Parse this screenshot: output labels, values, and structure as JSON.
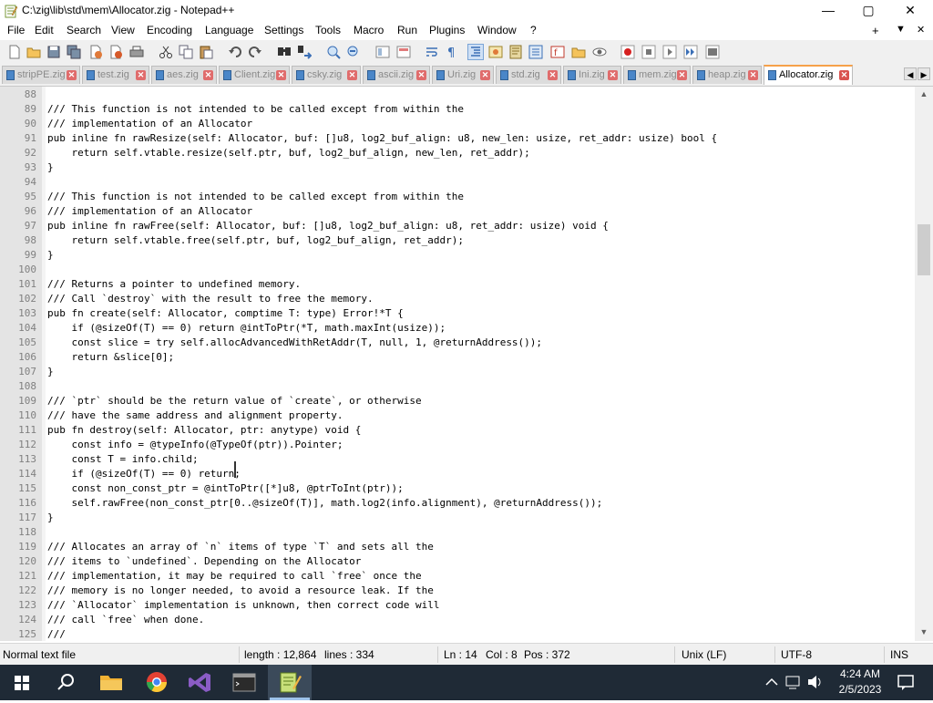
{
  "window": {
    "title": "C:\\zig\\lib\\std\\mem\\Allocator.zig - Notepad++",
    "controls": {
      "minimize": "—",
      "maximize": "▢",
      "close": "✕"
    }
  },
  "menu": {
    "items": [
      "File",
      "Edit",
      "Search",
      "View",
      "Encoding",
      "Language",
      "Settings",
      "Tools",
      "Macro",
      "Run",
      "Plugins",
      "Window",
      "?"
    ],
    "right": {
      "plus": "+",
      "dropdown": "▼",
      "close": "✕"
    }
  },
  "toolbar": {
    "icons": [
      "new-file-icon",
      "open-file-icon",
      "save-icon",
      "save-all-icon",
      "close-icon",
      "close-all-icon",
      "print-icon",
      "cut-icon",
      "copy-icon",
      "paste-icon",
      "undo-icon",
      "redo-icon",
      "find-icon",
      "replace-icon",
      "zoom-in-icon",
      "zoom-out-icon",
      "sync-vertical-icon",
      "sync-horizontal-icon",
      "word-wrap-icon",
      "show-all-chars-icon",
      "indent-guide-icon",
      "udl-icon",
      "doc-map-icon",
      "function-list-icon",
      "folder-as-workspace-icon",
      "monitor-icon",
      "record-macro-icon",
      "stop-record-icon",
      "play-macro-icon",
      "run-multiple-icon",
      "save-macro-icon"
    ]
  },
  "tabs": [
    {
      "label": "stripPE.zig",
      "active": false
    },
    {
      "label": "test.zig",
      "active": false
    },
    {
      "label": "aes.zig",
      "active": false
    },
    {
      "label": "Client.zig",
      "active": false
    },
    {
      "label": "csky.zig",
      "active": false
    },
    {
      "label": "ascii.zig",
      "active": false
    },
    {
      "label": "Uri.zig",
      "active": false
    },
    {
      "label": "std.zig",
      "active": false
    },
    {
      "label": "Ini.zig",
      "active": false
    },
    {
      "label": "mem.zig",
      "active": false
    },
    {
      "label": "heap.zig",
      "active": false
    },
    {
      "label": "Allocator.zig",
      "active": true
    }
  ],
  "tab_close": "✕",
  "tab_nav": {
    "left": "◀",
    "right": "▶"
  },
  "editor": {
    "lines": [
      {
        "n": "88",
        "t": ""
      },
      {
        "n": "89",
        "t": "/// This function is not intended to be called except from within the"
      },
      {
        "n": "90",
        "t": "/// implementation of an Allocator"
      },
      {
        "n": "91",
        "t": "pub inline fn rawResize(self: Allocator, buf: []u8, log2_buf_align: u8, new_len: usize, ret_addr: usize) bool {"
      },
      {
        "n": "92",
        "t": "    return self.vtable.resize(self.ptr, buf, log2_buf_align, new_len, ret_addr);"
      },
      {
        "n": "93",
        "t": "}"
      },
      {
        "n": "94",
        "t": ""
      },
      {
        "n": "95",
        "t": "/// This function is not intended to be called except from within the"
      },
      {
        "n": "96",
        "t": "/// implementation of an Allocator"
      },
      {
        "n": "97",
        "t": "pub inline fn rawFree(self: Allocator, buf: []u8, log2_buf_align: u8, ret_addr: usize) void {"
      },
      {
        "n": "98",
        "t": "    return self.vtable.free(self.ptr, buf, log2_buf_align, ret_addr);"
      },
      {
        "n": "99",
        "t": "}"
      },
      {
        "n": "100",
        "t": ""
      },
      {
        "n": "101",
        "t": "/// Returns a pointer to undefined memory."
      },
      {
        "n": "102",
        "t": "/// Call `destroy` with the result to free the memory."
      },
      {
        "n": "103",
        "t": "pub fn create(self: Allocator, comptime T: type) Error!*T {"
      },
      {
        "n": "104",
        "t": "    if (@sizeOf(T) == 0) return @intToPtr(*T, math.maxInt(usize));"
      },
      {
        "n": "105",
        "t": "    const slice = try self.allocAdvancedWithRetAddr(T, null, 1, @returnAddress());"
      },
      {
        "n": "106",
        "t": "    return &slice[0];"
      },
      {
        "n": "107",
        "t": "}"
      },
      {
        "n": "108",
        "t": ""
      },
      {
        "n": "109",
        "t": "/// `ptr` should be the return value of `create`, or otherwise"
      },
      {
        "n": "110",
        "t": "/// have the same address and alignment property."
      },
      {
        "n": "111",
        "t": "pub fn destroy(self: Allocator, ptr: anytype) void {"
      },
      {
        "n": "112",
        "t": "    const info = @typeInfo(@TypeOf(ptr)).Pointer;"
      },
      {
        "n": "113",
        "t": "    const T = info.child;"
      },
      {
        "n": "114",
        "t": "    if (@sizeOf(T) == 0) return;"
      },
      {
        "n": "115",
        "t": "    const non_const_ptr = @intToPtr([*]u8, @ptrToInt(ptr));"
      },
      {
        "n": "116",
        "t": "    self.rawFree(non_const_ptr[0..@sizeOf(T)], math.log2(info.alignment), @returnAddress());"
      },
      {
        "n": "117",
        "t": "}"
      },
      {
        "n": "118",
        "t": ""
      },
      {
        "n": "119",
        "t": "/// Allocates an array of `n` items of type `T` and sets all the"
      },
      {
        "n": "120",
        "t": "/// items to `undefined`. Depending on the Allocator"
      },
      {
        "n": "121",
        "t": "/// implementation, it may be required to call `free` once the"
      },
      {
        "n": "122",
        "t": "/// memory is no longer needed, to avoid a resource leak. If the"
      },
      {
        "n": "123",
        "t": "/// `Allocator` implementation is unknown, then correct code will"
      },
      {
        "n": "124",
        "t": "/// call `free` when done."
      },
      {
        "n": "125",
        "t": "///"
      }
    ]
  },
  "scrollbar": {
    "up": "▲",
    "down": "▼"
  },
  "status": {
    "type": "Normal text file",
    "length": "length : 12,864",
    "lines": "lines : 334",
    "ln": "Ln : 14",
    "col": "Col : 8",
    "pos": "Pos : 372",
    "eol": "Unix (LF)",
    "encoding": "UTF-8",
    "mode": "INS"
  },
  "taskbar": {
    "time": "4:24 AM",
    "date": "2/5/2023",
    "apps": [
      "windows-start-icon",
      "search-icon",
      "file-explorer-icon",
      "chrome-icon",
      "visual-studio-icon",
      "terminal-icon",
      "notepadpp-icon"
    ]
  }
}
